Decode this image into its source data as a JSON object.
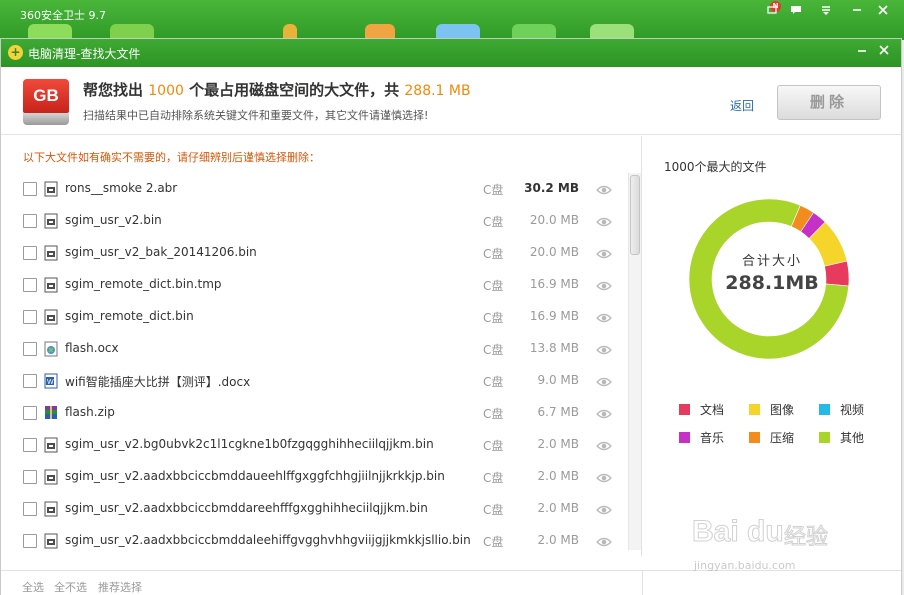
{
  "app": {
    "title": "360安全卫士 9.7",
    "notice_badge": "N"
  },
  "dialog": {
    "title": "电脑清理-查找大文件"
  },
  "header": {
    "icon_text": "GB",
    "headline_prefix": "帮您找出",
    "headline_count": "1000",
    "headline_middle": "个最占用磁盘空间的大文件，共",
    "headline_total": "288.1 MB",
    "subline": "扫描结果中已自动排除系统关键文件和重要文件，其它文件请谨慎选择!",
    "back_label": "返回",
    "delete_label": "删除"
  },
  "list": {
    "notice": "以下大文件如有确实不需要的，请仔细辨别后谨慎选择删除：",
    "files": [
      {
        "name": "rons__smoke 2.abr",
        "drive": "C盘",
        "size": "30.2 MB",
        "icon": "file-icon"
      },
      {
        "name": "sgim_usr_v2.bin",
        "drive": "C盘",
        "size": "20.0 MB",
        "icon": "file-icon"
      },
      {
        "name": "sgim_usr_v2_bak_20141206.bin",
        "drive": "C盘",
        "size": "20.0 MB",
        "icon": "file-icon"
      },
      {
        "name": "sgim_remote_dict.bin.tmp",
        "drive": "C盘",
        "size": "16.9 MB",
        "icon": "file-icon"
      },
      {
        "name": "sgim_remote_dict.bin",
        "drive": "C盘",
        "size": "16.9 MB",
        "icon": "file-icon"
      },
      {
        "name": "flash.ocx",
        "drive": "C盘",
        "size": "13.8 MB",
        "icon": "ocx-file-icon"
      },
      {
        "name": "wifi智能插座大比拼【测评】.docx",
        "drive": "C盘",
        "size": "9.0 MB",
        "icon": "word-file-icon"
      },
      {
        "name": "flash.zip",
        "drive": "C盘",
        "size": "6.7 MB",
        "icon": "zip-file-icon"
      },
      {
        "name": "sgim_usr_v2.bg0ubvk2c1l1cgkne1b0fzgqgghihheciilqjjkm.bin",
        "drive": "C盘",
        "size": "2.0 MB",
        "icon": "file-icon"
      },
      {
        "name": "sgim_usr_v2.aadxbbciccbmddaueehlffgxggfchhgjiilnjjkrkkjp.bin",
        "drive": "C盘",
        "size": "2.0 MB",
        "icon": "file-icon"
      },
      {
        "name": "sgim_usr_v2.aadxbbciccbmddareehfffgxgghihheciilqjjkm.bin",
        "drive": "C盘",
        "size": "2.0 MB",
        "icon": "file-icon"
      },
      {
        "name": "sgim_usr_v2.aadxbbciccbmddaleehiffgvgghvhhgviijgjjkmkkjsllio.bin",
        "drive": "C盘",
        "size": "2.0 MB",
        "icon": "file-icon"
      }
    ]
  },
  "summary": {
    "title": "1000个最大的文件",
    "center_label": "合计大小",
    "center_value": "288.1MB",
    "chart_data": {
      "type": "pie",
      "categories": [
        "文档",
        "图像",
        "视频",
        "音乐",
        "压缩",
        "其他"
      ],
      "values": [
        0.05,
        0.09,
        0.0,
        0.03,
        0.03,
        0.8
      ],
      "colors": [
        "#e83a5c",
        "#f5d52a",
        "#23b9e8",
        "#c531c6",
        "#f28c1f",
        "#a9d42a"
      ]
    },
    "legend": [
      {
        "label": "文档",
        "color": "#e83a5c"
      },
      {
        "label": "图像",
        "color": "#f5d52a"
      },
      {
        "label": "视频",
        "color": "#23b9e8"
      },
      {
        "label": "音乐",
        "color": "#c531c6"
      },
      {
        "label": "压缩",
        "color": "#f28c1f"
      },
      {
        "label": "其他",
        "color": "#a9d42a"
      }
    ]
  },
  "footer": {
    "select_all": "全选",
    "select_none": "全不选",
    "recommended": "推荐选择"
  },
  "watermark": {
    "brand": "Bai du",
    "label": "经验",
    "url": "jingyan.baidu.com"
  }
}
